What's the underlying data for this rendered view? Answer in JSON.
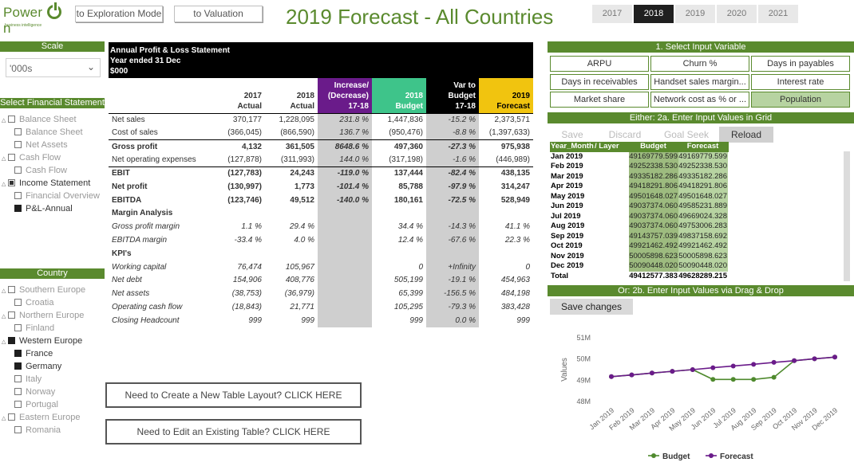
{
  "header": {
    "logo_text_a": "Power",
    "logo_text_b": "n",
    "logo_sub": "business intelligence",
    "btn_exploration": "to Exploration Mode",
    "btn_valuation": "to Valuation",
    "title_a": "2019 Forecast - ",
    "title_b": "All Countries",
    "years": [
      "2017",
      "2018",
      "2019",
      "2020",
      "2021"
    ],
    "active_year": "2018"
  },
  "left": {
    "scale_head": "Scale",
    "scale_value": "'000s",
    "fin_head": "Select Financial Statement",
    "fin_items": [
      {
        "label": "Balance Sheet",
        "level": 0,
        "state": "empty",
        "on": false
      },
      {
        "label": "Balance Sheet",
        "level": 1,
        "state": "empty",
        "on": false
      },
      {
        "label": "Net Assets",
        "level": 1,
        "state": "empty",
        "on": false
      },
      {
        "label": "Cash Flow",
        "level": 0,
        "state": "empty",
        "on": false
      },
      {
        "label": "Cash Flow",
        "level": 1,
        "state": "empty",
        "on": false
      },
      {
        "label": "Income Statement",
        "level": 0,
        "state": "part",
        "on": true
      },
      {
        "label": "Financial Overview",
        "level": 1,
        "state": "empty",
        "on": false
      },
      {
        "label": "P&L-Annual",
        "level": 1,
        "state": "full",
        "on": true
      }
    ],
    "country_head": "Country",
    "country_items": [
      {
        "label": "Southern Europe",
        "level": 0,
        "state": "empty",
        "on": false
      },
      {
        "label": "Croatia",
        "level": 1,
        "state": "empty",
        "on": false
      },
      {
        "label": "Northern Europe",
        "level": 0,
        "state": "empty",
        "on": false
      },
      {
        "label": "Finland",
        "level": 1,
        "state": "empty",
        "on": false
      },
      {
        "label": "Western Europe",
        "level": 0,
        "state": "full",
        "on": true
      },
      {
        "label": "France",
        "level": 1,
        "state": "full",
        "on": true
      },
      {
        "label": "Germany",
        "level": 1,
        "state": "full",
        "on": true
      },
      {
        "label": "Italy",
        "level": 1,
        "state": "empty",
        "on": false
      },
      {
        "label": "Norway",
        "level": 1,
        "state": "empty",
        "on": false
      },
      {
        "label": "Portugal",
        "level": 1,
        "state": "empty",
        "on": false
      },
      {
        "label": "Eastern Europe",
        "level": 0,
        "state": "empty",
        "on": false
      },
      {
        "label": "Romania",
        "level": 1,
        "state": "empty",
        "on": false
      }
    ]
  },
  "pl": {
    "head_line1": "Annual Profit & Loss Statement",
    "head_line2": "Year ended 31 Dec",
    "head_line3": "$000",
    "columns": [
      [
        "2017",
        "Actual"
      ],
      [
        "2018",
        "Actual"
      ],
      [
        "Increase/",
        "(Decrease)",
        "17-18"
      ],
      [
        "2018",
        "Budget"
      ],
      [
        "Var to",
        "Budget",
        "17-18"
      ],
      [
        "2019",
        "Forecast"
      ]
    ],
    "rows": [
      {
        "label": "Net sales",
        "style": "",
        "vals": [
          "370,177",
          "1,228,095",
          "231.8 %",
          "1,447,836",
          "-15.2 %",
          "2,373,571"
        ]
      },
      {
        "label": "Cost of sales",
        "style": "",
        "vals": [
          "(366,045)",
          "(866,590)",
          "136.7 %",
          "(950,476)",
          "-8.8 %",
          "(1,397,633)"
        ]
      },
      {
        "label": "Gross profit",
        "style": "b sep",
        "vals": [
          "4,132",
          "361,505",
          "8648.6 %",
          "497,360",
          "-27.3 %",
          "975,938"
        ]
      },
      {
        "label": "Net operating expenses",
        "style": "",
        "vals": [
          "(127,878)",
          "(311,993)",
          "144.0 %",
          "(317,198)",
          "-1.6 %",
          "(446,989)"
        ]
      },
      {
        "label": "EBIT",
        "style": "b sep",
        "vals": [
          "(127,783)",
          "24,243",
          "-119.0 %",
          "137,444",
          "-82.4 %",
          "438,135"
        ]
      },
      {
        "label": "Net profit",
        "style": "b",
        "vals": [
          "(130,997)",
          "1,773",
          "-101.4 %",
          "85,788",
          "-97.9 %",
          "314,247"
        ]
      },
      {
        "label": "EBITDA",
        "style": "b",
        "vals": [
          "(123,746)",
          "49,512",
          "-140.0 %",
          "180,161",
          "-72.5 %",
          "528,949"
        ]
      },
      {
        "label": "Margin Analysis",
        "style": "b",
        "vals": [
          "",
          "",
          "",
          "",
          "",
          ""
        ]
      },
      {
        "label": "Gross profit margin",
        "style": "it",
        "vals": [
          "1.1 %",
          "29.4 %",
          "",
          "34.4 %",
          "-14.3 %",
          "41.1 %"
        ]
      },
      {
        "label": "EBITDA margin",
        "style": "it",
        "vals": [
          "-33.4 %",
          "4.0 %",
          "",
          "12.4 %",
          "-67.6 %",
          "22.3 %"
        ]
      },
      {
        "label": "KPI's",
        "style": "b",
        "vals": [
          "",
          "",
          "",
          "",
          "",
          ""
        ]
      },
      {
        "label": "Working capital",
        "style": "it",
        "vals": [
          "76,474",
          "105,967",
          "",
          "0",
          "+Infinity",
          "0"
        ]
      },
      {
        "label": "Net debt",
        "style": "it",
        "vals": [
          "154,906",
          "408,776",
          "",
          "505,199",
          "-19.1 %",
          "454,963"
        ]
      },
      {
        "label": "Net assets",
        "style": "it",
        "vals": [
          "(38,753)",
          "(36,979)",
          "",
          "65,399",
          "-156.5 %",
          "484,198"
        ]
      },
      {
        "label": "Operating cash flow",
        "style": "it",
        "vals": [
          "(18,843)",
          "21,771",
          "",
          "105,295",
          "-79.3 %",
          "383,428"
        ]
      },
      {
        "label": "Closing Headcount",
        "style": "it",
        "vals": [
          "999",
          "999",
          "",
          "999",
          "0.0 %",
          "999"
        ]
      }
    ],
    "btn_new": "Need to Create a New Table Layout? CLICK HERE",
    "btn_edit": "Need to Edit an Existing Table? CLICK HERE"
  },
  "right": {
    "select_head": "1. Select Input Variable",
    "vars": [
      "ARPU",
      "Churn %",
      "Days in payables",
      "Days in receivables",
      "Handset sales margin...",
      "Interest rate",
      "Market share",
      "Network cost as % or ...",
      "Population"
    ],
    "selected_var": "Population",
    "grid_head": "Either: 2a. Enter Input Values in Grid",
    "tools": [
      "Save",
      "Discard",
      "Goal Seek",
      "Reload"
    ],
    "active_tool": "Reload",
    "grid_cols": [
      "Year_Month",
      "/ Layer",
      "Budget",
      "Forecast"
    ],
    "grid_rows": [
      [
        "Jan 2019",
        "49169779.599",
        "49169779.599"
      ],
      [
        "Feb 2019",
        "49252338.530",
        "49252338.530"
      ],
      [
        "Mar 2019",
        "49335182.286",
        "49335182.286"
      ],
      [
        "Apr 2019",
        "49418291.806",
        "49418291.806"
      ],
      [
        "May 2019",
        "49501648.027",
        "49501648.027"
      ],
      [
        "Jun 2019",
        "49037374.060",
        "49585231.889"
      ],
      [
        "Jul 2019",
        "49037374.060",
        "49669024.328"
      ],
      [
        "Aug 2019",
        "49037374.060",
        "49753006.283"
      ],
      [
        "Sep 2019",
        "49143757.039",
        "49837158.692"
      ],
      [
        "Oct 2019",
        "49921462.492",
        "49921462.492"
      ],
      [
        "Nov 2019",
        "50005898.623",
        "50005898.623"
      ],
      [
        "Dec 2019",
        "50090448.020",
        "50090448.020"
      ]
    ],
    "grid_total": [
      "Total",
      "49412577.383",
      "49628289.215"
    ],
    "drag_head": "Or: 2b. Enter Input Values via Drag & Drop",
    "save_changes": "Save changes"
  },
  "chart_data": {
    "type": "line",
    "categories": [
      "Jan 2019",
      "Feb 2019",
      "Mar 2019",
      "Apr 2019",
      "May 2019",
      "Jun 2019",
      "Jul 2019",
      "Aug 2019",
      "Sep 2019",
      "Oct 2019",
      "Nov 2019",
      "Dec 2019"
    ],
    "series": [
      {
        "name": "Budget",
        "color": "#4f8a2e",
        "values": [
          49.17,
          49.25,
          49.34,
          49.42,
          49.5,
          49.04,
          49.04,
          49.04,
          49.14,
          49.92,
          50.01,
          50.09
        ]
      },
      {
        "name": "Forecast",
        "color": "#6a1b8a",
        "values": [
          49.17,
          49.25,
          49.34,
          49.42,
          49.5,
          49.59,
          49.67,
          49.75,
          49.84,
          49.92,
          50.01,
          50.09
        ]
      }
    ],
    "ylabel": "Values",
    "yticks": [
      "48M",
      "49M",
      "50M",
      "51M"
    ],
    "ylim": [
      48,
      51
    ],
    "legend": "bottom"
  }
}
